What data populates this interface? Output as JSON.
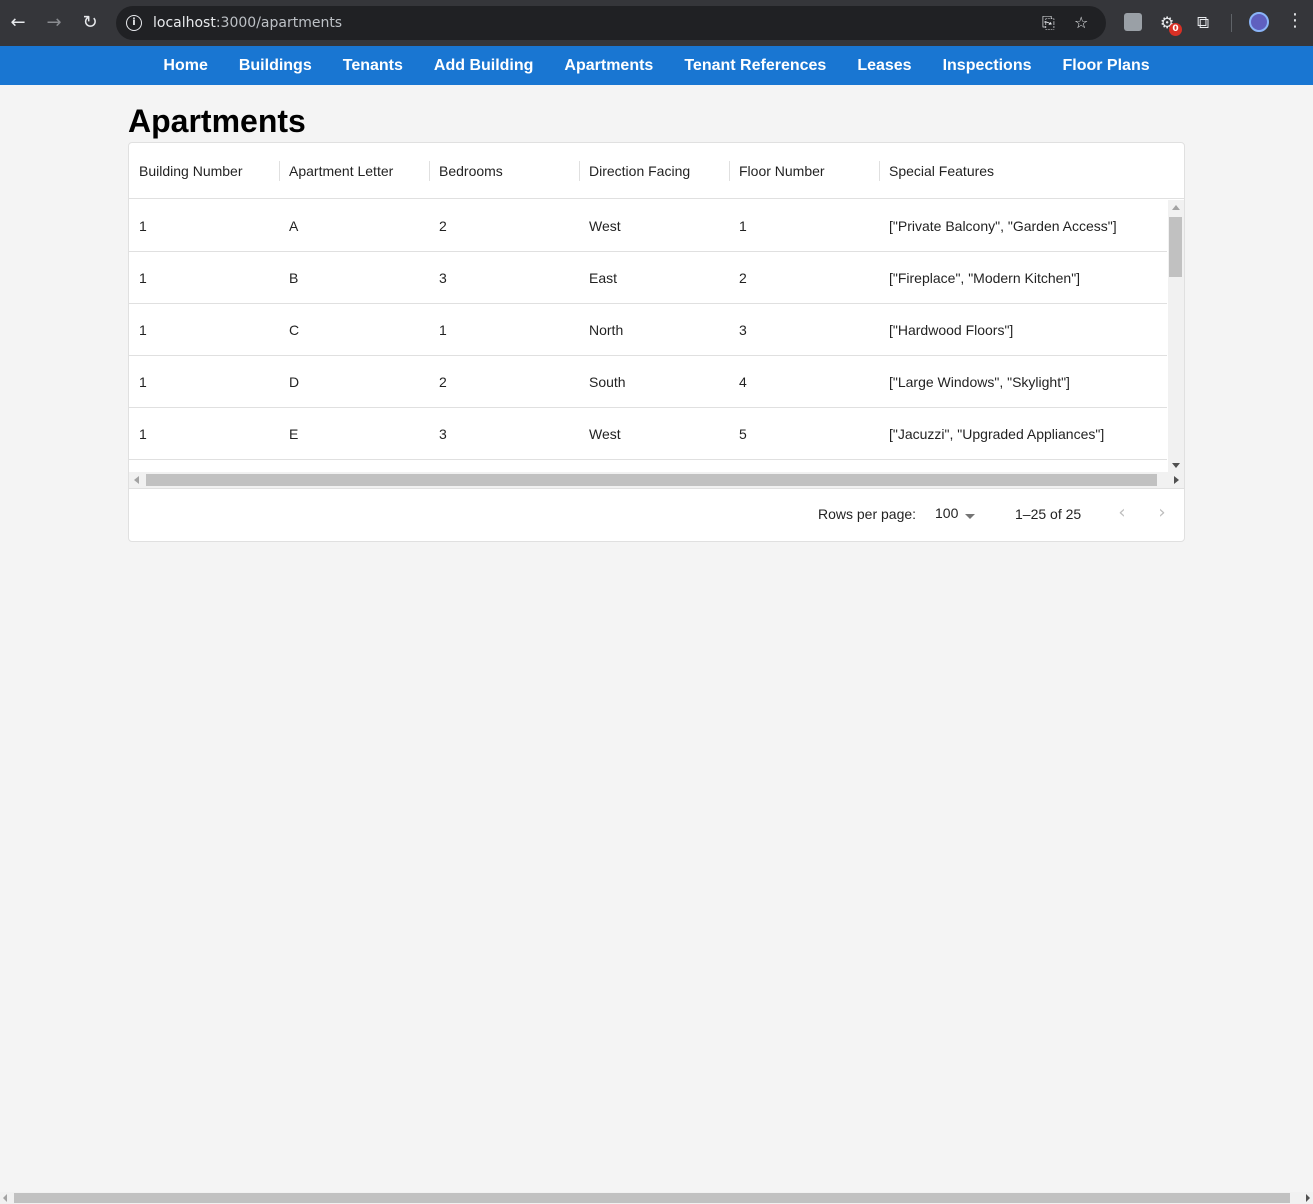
{
  "browser": {
    "url_host": "localhost",
    "url_path": ":3000/apartments",
    "ext_badge": "0"
  },
  "nav": {
    "items": [
      "Home",
      "Buildings",
      "Tenants",
      "Add Building",
      "Apartments",
      "Tenant References",
      "Leases",
      "Inspections",
      "Floor Plans"
    ]
  },
  "page": {
    "title": "Apartments"
  },
  "table": {
    "columns": [
      "Building Number",
      "Apartment Letter",
      "Bedrooms",
      "Direction Facing",
      "Floor Number",
      "Special Features"
    ],
    "rows": [
      [
        "1",
        "A",
        "2",
        "West",
        "1",
        "[\"Private Balcony\", \"Garden Access\"]"
      ],
      [
        "1",
        "B",
        "3",
        "East",
        "2",
        "[\"Fireplace\", \"Modern Kitchen\"]"
      ],
      [
        "1",
        "C",
        "1",
        "North",
        "3",
        "[\"Hardwood Floors\"]"
      ],
      [
        "1",
        "D",
        "2",
        "South",
        "4",
        "[\"Large Windows\", \"Skylight\"]"
      ],
      [
        "1",
        "E",
        "3",
        "West",
        "5",
        "[\"Jacuzzi\", \"Upgraded Appliances\"]"
      ]
    ]
  },
  "pagination": {
    "rows_per_page_label": "Rows per page:",
    "rows_per_page_value": "100",
    "range_label": "1–25 of 25"
  },
  "icons": {
    "back": "back-arrow-icon",
    "forward": "forward-arrow-icon",
    "reload": "reload-icon",
    "info": "site-info-icon",
    "install": "install-app-icon",
    "bookmark": "star-icon",
    "extensions": "puzzle-icon",
    "menu": "kebab-menu-icon"
  }
}
